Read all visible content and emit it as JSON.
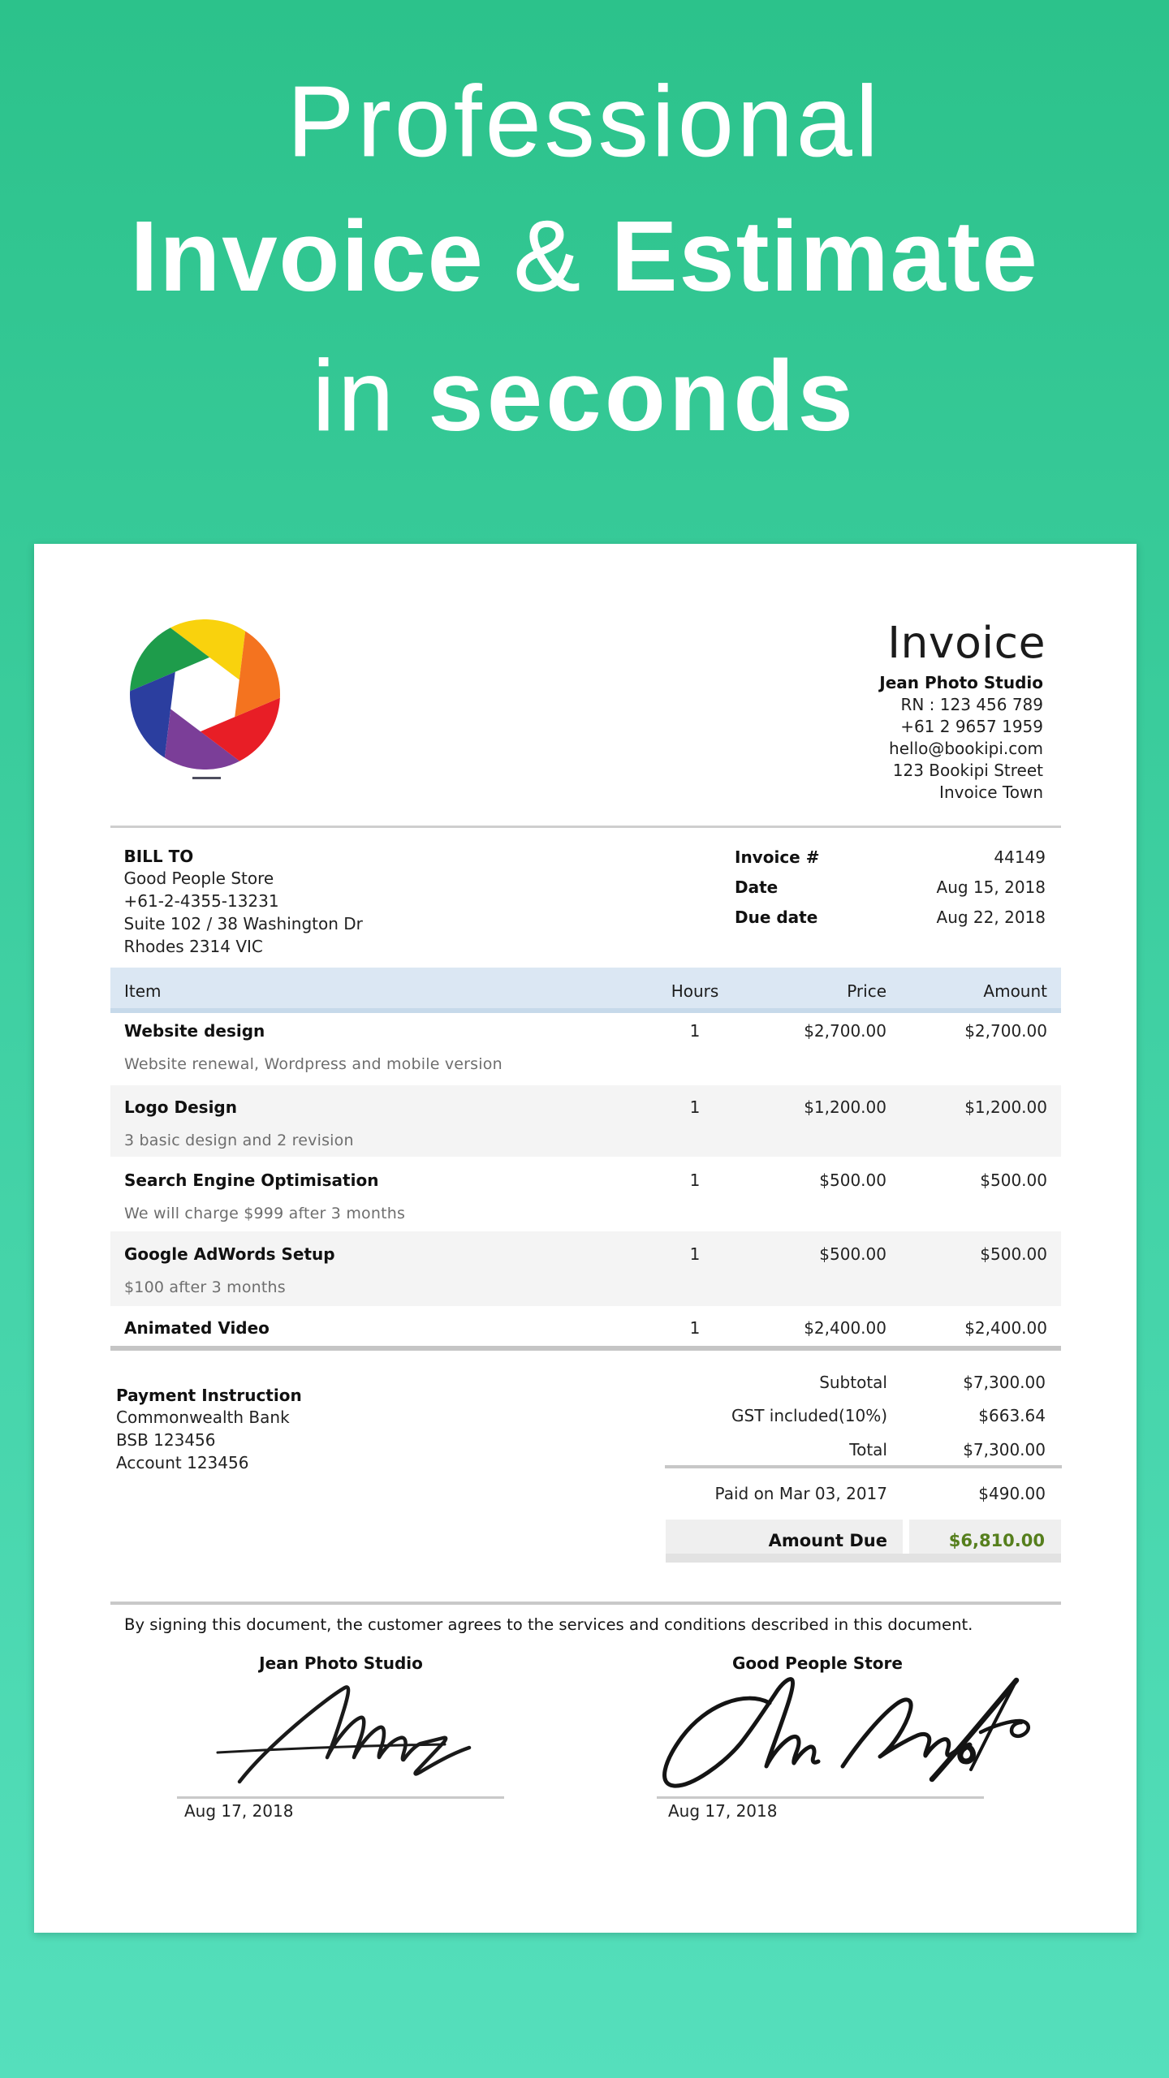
{
  "hero": {
    "line1": "Professional",
    "line2_word1": "Invoice",
    "line2_amp": "&",
    "line2_word2": "Estimate",
    "line3_light": "in",
    "line3_bold": "seconds"
  },
  "colors": {
    "background_top": "#2cc28b",
    "background_bottom": "#55dfbc",
    "table_header_blue": "#dbe7f3",
    "amount_due_green": "#567f1d"
  },
  "invoice": {
    "title": "Invoice",
    "company": {
      "name": "Jean Photo Studio",
      "lines": [
        "RN : 123 456 789",
        "+61 2 9657 1959",
        "hello@bookipi.com",
        "123 Bookipi Street",
        "Invoice Town"
      ]
    },
    "logo": "rainbow-shutter-logo",
    "bill_to": {
      "label": "BILL TO",
      "lines": [
        "Good People Store",
        "+61-2-4355-13231",
        "Suite 102 / 38 Washington Dr",
        "Rhodes 2314 VIC"
      ]
    },
    "meta": {
      "rows": [
        {
          "label": "Invoice #",
          "value": "44149"
        },
        {
          "label": "Date",
          "value": "Aug 15, 2018"
        },
        {
          "label": "Due date",
          "value": "Aug 22, 2018"
        }
      ]
    },
    "table": {
      "headers": {
        "item": "Item",
        "hours": "Hours",
        "price": "Price",
        "amount": "Amount"
      },
      "rows": [
        {
          "name": "Website design",
          "desc": "Website renewal, Wordpress and mobile version",
          "hours": "1",
          "price": "$2,700.00",
          "amount": "$2,700.00"
        },
        {
          "name": "Logo Design",
          "desc": "3 basic design and 2 revision",
          "hours": "1",
          "price": "$1,200.00",
          "amount": "$1,200.00"
        },
        {
          "name": "Search Engine Optimisation",
          "desc": "We will charge $999 after 3 months",
          "hours": "1",
          "price": "$500.00",
          "amount": "$500.00"
        },
        {
          "name": "Google AdWords Setup",
          "desc": "$100 after 3 months",
          "hours": "1",
          "price": "$500.00",
          "amount": "$500.00"
        },
        {
          "name": "Animated Video",
          "desc": "",
          "hours": "1",
          "price": "$2,400.00",
          "amount": "$2,400.00"
        }
      ]
    },
    "payment": {
      "label": "Payment Instruction",
      "lines": [
        "Commonwealth Bank",
        "BSB 123456",
        "Account 123456"
      ]
    },
    "totals": {
      "rows": [
        {
          "label": "Subtotal",
          "value": "$7,300.00"
        },
        {
          "label": "GST included(10%)",
          "value": "$663.64"
        },
        {
          "label": "Total",
          "value": "$7,300.00"
        }
      ],
      "paid": {
        "label": "Paid on Mar 03, 2017",
        "value": "$490.00"
      },
      "due": {
        "label": "Amount Due",
        "value": "$6,810.00"
      }
    },
    "signature_note": "By signing this document, the customer agrees to the services and conditions described in this document.",
    "signatures": [
      {
        "name": "Jean Photo Studio",
        "date": "Aug 17, 2018"
      },
      {
        "name": "Good People Store",
        "date": "Aug 17, 2018"
      }
    ]
  }
}
